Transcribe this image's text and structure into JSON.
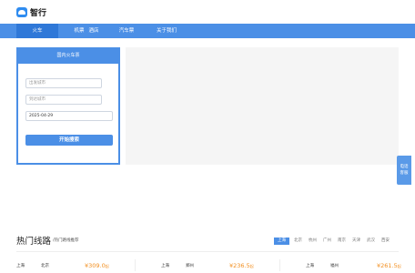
{
  "logo": {
    "text": "智行"
  },
  "nav": {
    "items": [
      {
        "label": "火车",
        "active": true
      },
      {
        "label": "机票"
      },
      {
        "label": "酒店"
      },
      {
        "label": "汽车票"
      },
      {
        "label": "关于我们"
      }
    ]
  },
  "search": {
    "title": "国内火车票",
    "from_placeholder": "出发城市",
    "to_placeholder": "到达城市",
    "date_value": "2025-04-29",
    "submit_label": "开始搜索"
  },
  "float": {
    "line1": "电话",
    "line2": "客服"
  },
  "hot": {
    "title": "热门线路",
    "subtitle": "/热门路线推荐",
    "cities": [
      "上海",
      "北京",
      "杭州",
      "广州",
      "南京",
      "天津",
      "武汉",
      "西安"
    ],
    "active_city": "上海",
    "routes": [
      {
        "from": "上海",
        "to": "北京",
        "price": "¥309.0",
        "unit": "起"
      },
      {
        "from": "上海",
        "to": "郑州",
        "price": "¥236.5",
        "unit": "起"
      },
      {
        "from": "上海",
        "to": "福州",
        "price": "¥261.5",
        "unit": "起"
      }
    ]
  },
  "colors": {
    "primary": "#4b8fe6",
    "nav_active": "#2f78d8",
    "price": "#f28f20"
  }
}
